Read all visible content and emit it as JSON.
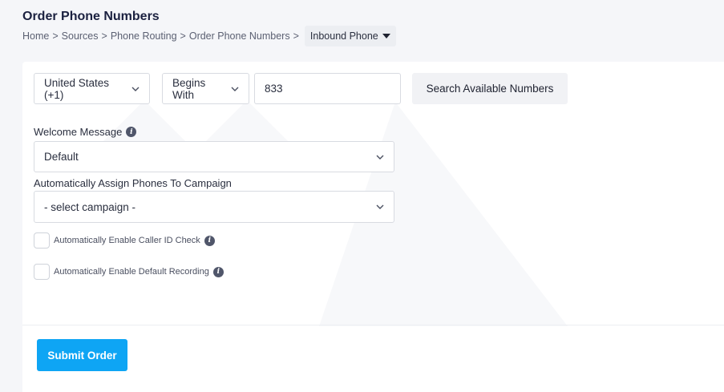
{
  "header": {
    "title": "Order Phone Numbers",
    "breadcrumb": [
      "Home",
      "Sources",
      "Phone Routing",
      "Order Phone Numbers"
    ],
    "breadcrumb_separator": ">",
    "current_dropdown": "Inbound Phone"
  },
  "search": {
    "country": "United States (+1)",
    "match_mode": "Begins With",
    "number_value": "833",
    "search_button": "Search Available Numbers"
  },
  "welcome_message": {
    "label": "Welcome Message",
    "value": "Default"
  },
  "campaign": {
    "label": "Automatically Assign Phones To Campaign",
    "value": "- select campaign -"
  },
  "options": {
    "caller_id_check": "Automatically Enable Caller ID Check",
    "default_recording": "Automatically Enable Default Recording"
  },
  "footer": {
    "submit_button": "Submit Order"
  },
  "colors": {
    "primary": "#0ea5f4",
    "title": "#1b2140",
    "info_icon": "#50566a"
  }
}
